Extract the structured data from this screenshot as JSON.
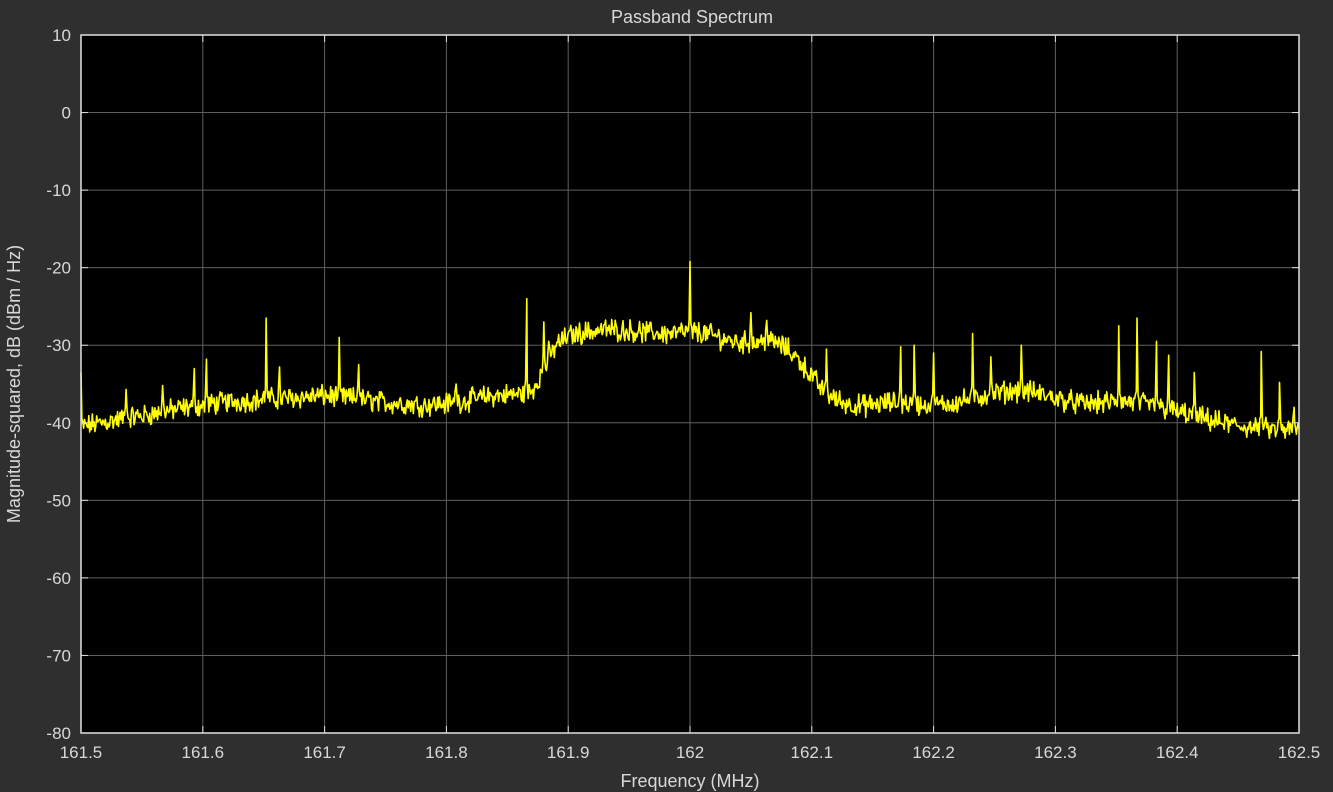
{
  "window": {
    "background": "#2f2f2f"
  },
  "chart_data": {
    "type": "line",
    "title": "Passband Spectrum",
    "xlabel": "Frequency (MHz)",
    "ylabel": "Magnitude-squared, dB (dBm / Hz)",
    "xlim": [
      161.5,
      162.5
    ],
    "ylim": [
      -80,
      10
    ],
    "x_ticks": [
      161.5,
      161.6,
      161.7,
      161.8,
      161.9,
      162,
      162.1,
      162.2,
      162.3,
      162.4,
      162.5
    ],
    "x_tick_labels": [
      "161.5",
      "161.6",
      "161.7",
      "161.8",
      "161.9",
      "162",
      "162.1",
      "162.2",
      "162.3",
      "162.4",
      "162.5"
    ],
    "y_ticks": [
      -80,
      -70,
      -60,
      -50,
      -40,
      -30,
      -20,
      -10,
      0,
      10
    ],
    "y_tick_labels": [
      "-80",
      "-70",
      "-60",
      "-50",
      "-40",
      "-30",
      "-20",
      "-10",
      "0",
      "10"
    ],
    "grid": true,
    "colors": {
      "plot_background": "#000000",
      "grid": "#5f5f5f",
      "axes": "#e0e0e0",
      "line": "#ffff00",
      "text": "#d8d8d8"
    },
    "series": [
      {
        "values_note": "",
        "x": [
          161.5,
          161.51,
          161.52,
          161.53,
          161.54,
          161.55,
          161.56,
          161.57,
          161.58,
          161.59,
          161.6,
          161.61,
          161.62,
          161.63,
          161.64,
          161.65,
          161.66,
          161.67,
          161.68,
          161.69,
          161.7,
          161.71,
          161.72,
          161.73,
          161.74,
          161.75,
          161.76,
          161.77,
          161.78,
          161.79,
          161.8,
          161.81,
          161.82,
          161.83,
          161.84,
          161.85,
          161.86,
          161.87,
          161.88,
          161.89,
          161.9,
          161.91,
          161.92,
          161.93,
          161.94,
          161.95,
          161.96,
          161.97,
          161.98,
          161.99,
          162,
          162.01,
          162.02,
          162.03,
          162.04,
          162.05,
          162.06,
          162.07,
          162.08,
          162.09,
          162.1,
          162.11,
          162.12,
          162.13,
          162.14,
          162.15,
          162.16,
          162.17,
          162.18,
          162.19,
          162.2,
          162.21,
          162.22,
          162.23,
          162.24,
          162.25,
          162.26,
          162.27,
          162.28,
          162.29,
          162.3,
          162.31,
          162.32,
          162.33,
          162.34,
          162.35,
          162.36,
          162.37,
          162.38,
          162.39,
          162.4,
          162.41,
          162.42,
          162.43,
          162.44,
          162.45,
          162.46,
          162.47,
          162.48,
          162.49,
          162.5
        ],
        "y": [
          -40.5,
          -40.2,
          -39.9,
          -39.6,
          -39.3,
          -39.1,
          -38.8,
          -38.5,
          -38.2,
          -38.0,
          -37.8,
          -37.5,
          -37.3,
          -37.2,
          -37.1,
          -37.0,
          -36.9,
          -36.8,
          -36.7,
          -36.6,
          -36.5,
          -36.6,
          -36.8,
          -37.0,
          -37.2,
          -37.4,
          -37.5,
          -37.6,
          -37.7,
          -37.6,
          -37.5,
          -37.3,
          -37.0,
          -36.7,
          -36.5,
          -36.4,
          -36.3,
          -36.0,
          -33.0,
          -30.0,
          -28.8,
          -28.4,
          -28.2,
          -28.0,
          -28.0,
          -28.1,
          -28.3,
          -28.4,
          -28.5,
          -28.4,
          -28.2,
          -28.4,
          -28.8,
          -29.3,
          -29.6,
          -29.7,
          -29.5,
          -29.6,
          -30.5,
          -32.0,
          -34.0,
          -36.0,
          -37.0,
          -37.6,
          -37.8,
          -37.7,
          -37.5,
          -37.4,
          -37.5,
          -37.7,
          -37.8,
          -37.6,
          -37.3,
          -36.9,
          -36.6,
          -36.2,
          -36.0,
          -35.8,
          -36.0,
          -36.4,
          -36.8,
          -37.2,
          -37.5,
          -37.5,
          -37.4,
          -37.3,
          -37.3,
          -37.5,
          -37.8,
          -38.2,
          -38.6,
          -39.0,
          -39.4,
          -39.8,
          -40.1,
          -40.4,
          -40.6,
          -40.8,
          -40.9,
          -41.0,
          -41.0
        ],
        "spikes": [
          {
            "x": 161.5,
            "y": -33.5
          },
          {
            "x": 161.537,
            "y": -35.7
          },
          {
            "x": 161.567,
            "y": -35.2
          },
          {
            "x": 161.593,
            "y": -33.0
          },
          {
            "x": 161.603,
            "y": -31.8
          },
          {
            "x": 161.652,
            "y": -26.5
          },
          {
            "x": 161.663,
            "y": -32.8
          },
          {
            "x": 161.712,
            "y": -29.0
          },
          {
            "x": 161.728,
            "y": -32.5
          },
          {
            "x": 161.808,
            "y": -35.0
          },
          {
            "x": 161.866,
            "y": -24.0
          },
          {
            "x": 161.88,
            "y": -27.0
          },
          {
            "x": 161.884,
            "y": -29.5
          },
          {
            "x": 162.0,
            "y": -19.2
          },
          {
            "x": 162.05,
            "y": -25.8
          },
          {
            "x": 162.063,
            "y": -26.8
          },
          {
            "x": 162.112,
            "y": -30.5
          },
          {
            "x": 162.173,
            "y": -30.2
          },
          {
            "x": 162.184,
            "y": -30.0
          },
          {
            "x": 162.2,
            "y": -31.0
          },
          {
            "x": 162.232,
            "y": -28.5
          },
          {
            "x": 162.247,
            "y": -31.5
          },
          {
            "x": 162.272,
            "y": -30.0
          },
          {
            "x": 162.352,
            "y": -27.5
          },
          {
            "x": 162.367,
            "y": -26.5
          },
          {
            "x": 162.383,
            "y": -29.5
          },
          {
            "x": 162.393,
            "y": -31.3
          },
          {
            "x": 162.414,
            "y": -33.5
          },
          {
            "x": 162.469,
            "y": -30.8
          },
          {
            "x": 162.484,
            "y": -34.8
          },
          {
            "x": 162.496,
            "y": -38.0
          }
        ]
      }
    ]
  }
}
